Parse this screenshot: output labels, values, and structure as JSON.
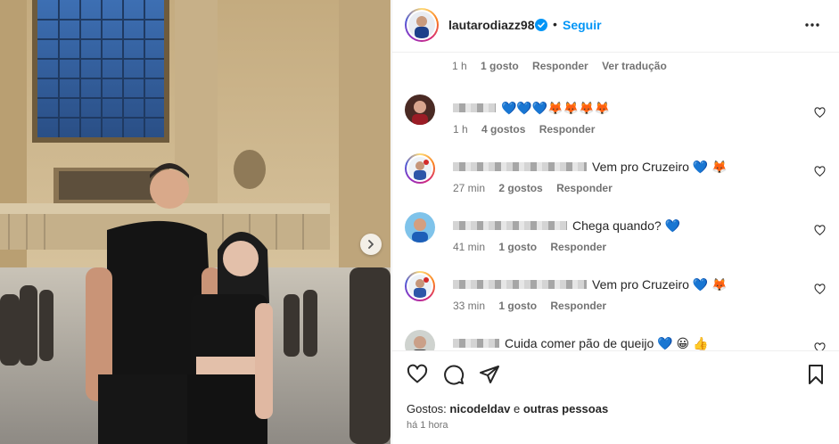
{
  "post": {
    "username": "lautarodiazz98",
    "verified_icon": "verified-badge-icon",
    "separator": "•",
    "follow_label": "Seguir",
    "more_icon": "more-options-icon"
  },
  "caption_meta": {
    "time": "1 h",
    "likes": "1 gosto",
    "reply": "Responder",
    "translate": "Ver tradução"
  },
  "comments": [
    {
      "text": "",
      "emojis": "💙💙💙🦊🦊🦊🦊",
      "time": "1 h",
      "likes": "4 gostos",
      "reply": "Responder"
    },
    {
      "text": "Vem pro Cruzeiro 💙 🦊",
      "time": "27 min",
      "likes": "2 gostos",
      "reply": "Responder"
    },
    {
      "text": "Chega quando? 💙",
      "time": "41 min",
      "likes": "1 gosto",
      "reply": "Responder"
    },
    {
      "text": "Vem pro Cruzeiro 💙 🦊",
      "time": "33 min",
      "likes": "1 gosto",
      "reply": "Responder"
    },
    {
      "text": "Cuida comer pão de queijo 💙 😀 👍",
      "time": "",
      "likes": "",
      "reply": ""
    }
  ],
  "footer": {
    "likes_prefix": "Gostos: ",
    "likes_user": "nicodeldav",
    "likes_connector": " e ",
    "likes_others": "outras pessoas",
    "time_ago": "há 1 hora"
  },
  "colors": {
    "accent": "#0095f6",
    "text": "#262626",
    "muted": "#737373",
    "divider": "#efefef"
  }
}
